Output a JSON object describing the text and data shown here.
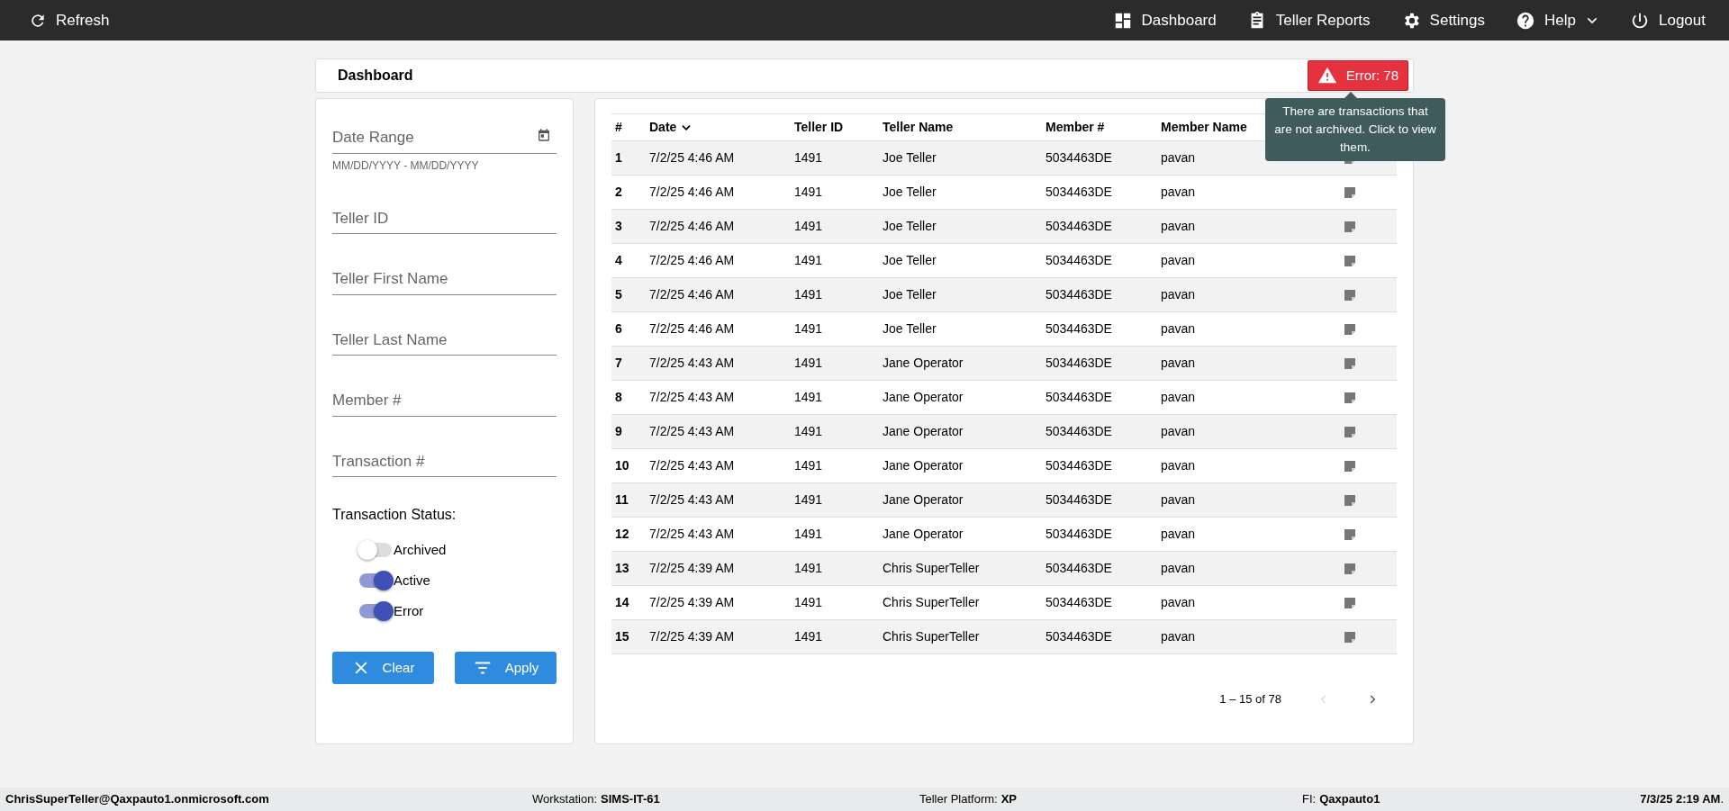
{
  "navbar": {
    "refresh": "Refresh",
    "links": [
      {
        "kind": "dashboard",
        "label": "Dashboard"
      },
      {
        "kind": "reports",
        "label": "Teller Reports"
      },
      {
        "kind": "settings",
        "label": "Settings"
      },
      {
        "kind": "help",
        "label": "Help",
        "dropdown": true
      },
      {
        "kind": "logout",
        "label": "Logout"
      }
    ]
  },
  "header": {
    "title": "Dashboard",
    "error_badge": "Error: 78",
    "tooltip": "There are transactions that are not archived. Click to view them."
  },
  "filters": {
    "fields": [
      {
        "placeholder": "Date Range",
        "hint": "MM/DD/YYYY - MM/DD/YYYY",
        "kind": "date"
      },
      {
        "placeholder": "Teller ID",
        "kind": "text"
      },
      {
        "placeholder": "Teller First Name",
        "kind": "text"
      },
      {
        "placeholder": "Teller Last Name",
        "kind": "text"
      },
      {
        "placeholder": "Member #",
        "kind": "text"
      },
      {
        "placeholder": "Transaction #",
        "kind": "text"
      }
    ],
    "status_label": "Transaction Status:",
    "statuses": [
      {
        "label": "Archived",
        "on": false
      },
      {
        "label": "Active",
        "on": true
      },
      {
        "label": "Error",
        "on": true
      }
    ],
    "buttons": [
      {
        "kind": "clear",
        "label": "Clear"
      },
      {
        "kind": "apply",
        "label": "Apply"
      }
    ]
  },
  "table": {
    "columns": [
      {
        "label": "#",
        "sorted": false
      },
      {
        "label": "Date",
        "sorted": true
      },
      {
        "label": "Teller ID",
        "sorted": false
      },
      {
        "label": "Teller Name",
        "sorted": false
      },
      {
        "label": "Member #",
        "sorted": false
      },
      {
        "label": "Member Name",
        "sorted": false
      }
    ],
    "rows": [
      [
        "1",
        "7/2/25 4:46 AM",
        "1491",
        "Joe Teller",
        "5034463DE",
        "pavan"
      ],
      [
        "2",
        "7/2/25 4:46 AM",
        "1491",
        "Joe Teller",
        "5034463DE",
        "pavan"
      ],
      [
        "3",
        "7/2/25 4:46 AM",
        "1491",
        "Joe Teller",
        "5034463DE",
        "pavan"
      ],
      [
        "4",
        "7/2/25 4:46 AM",
        "1491",
        "Joe Teller",
        "5034463DE",
        "pavan"
      ],
      [
        "5",
        "7/2/25 4:46 AM",
        "1491",
        "Joe Teller",
        "5034463DE",
        "pavan"
      ],
      [
        "6",
        "7/2/25 4:46 AM",
        "1491",
        "Joe Teller",
        "5034463DE",
        "pavan"
      ],
      [
        "7",
        "7/2/25 4:43 AM",
        "1491",
        "Jane Operator",
        "5034463DE",
        "pavan"
      ],
      [
        "8",
        "7/2/25 4:43 AM",
        "1491",
        "Jane Operator",
        "5034463DE",
        "pavan"
      ],
      [
        "9",
        "7/2/25 4:43 AM",
        "1491",
        "Jane Operator",
        "5034463DE",
        "pavan"
      ],
      [
        "10",
        "7/2/25 4:43 AM",
        "1491",
        "Jane Operator",
        "5034463DE",
        "pavan"
      ],
      [
        "11",
        "7/2/25 4:43 AM",
        "1491",
        "Jane Operator",
        "5034463DE",
        "pavan"
      ],
      [
        "12",
        "7/2/25 4:43 AM",
        "1491",
        "Jane Operator",
        "5034463DE",
        "pavan"
      ],
      [
        "13",
        "7/2/25 4:39 AM",
        "1491",
        "Chris SuperTeller",
        "5034463DE",
        "pavan"
      ],
      [
        "14",
        "7/2/25 4:39 AM",
        "1491",
        "Chris SuperTeller",
        "5034463DE",
        "pavan"
      ],
      [
        "15",
        "7/2/25 4:39 AM",
        "1491",
        "Chris SuperTeller",
        "5034463DE",
        "pavan"
      ]
    ],
    "pagination": {
      "range": "1 – 15 of 78",
      "prev_disabled": true,
      "next_disabled": false
    }
  },
  "status_bar": {
    "user": "ChrisSuperTeller@Qaxpauto1.onmicrosoft.com",
    "items": [
      {
        "label": "Workstation:",
        "value": "SIMS-IT-61"
      },
      {
        "label": "Teller Platform:",
        "value": "XP"
      },
      {
        "label": "FI:",
        "value": "Qaxpauto1"
      }
    ],
    "datetime": "**7/3/25 2:19 AM**."
  }
}
